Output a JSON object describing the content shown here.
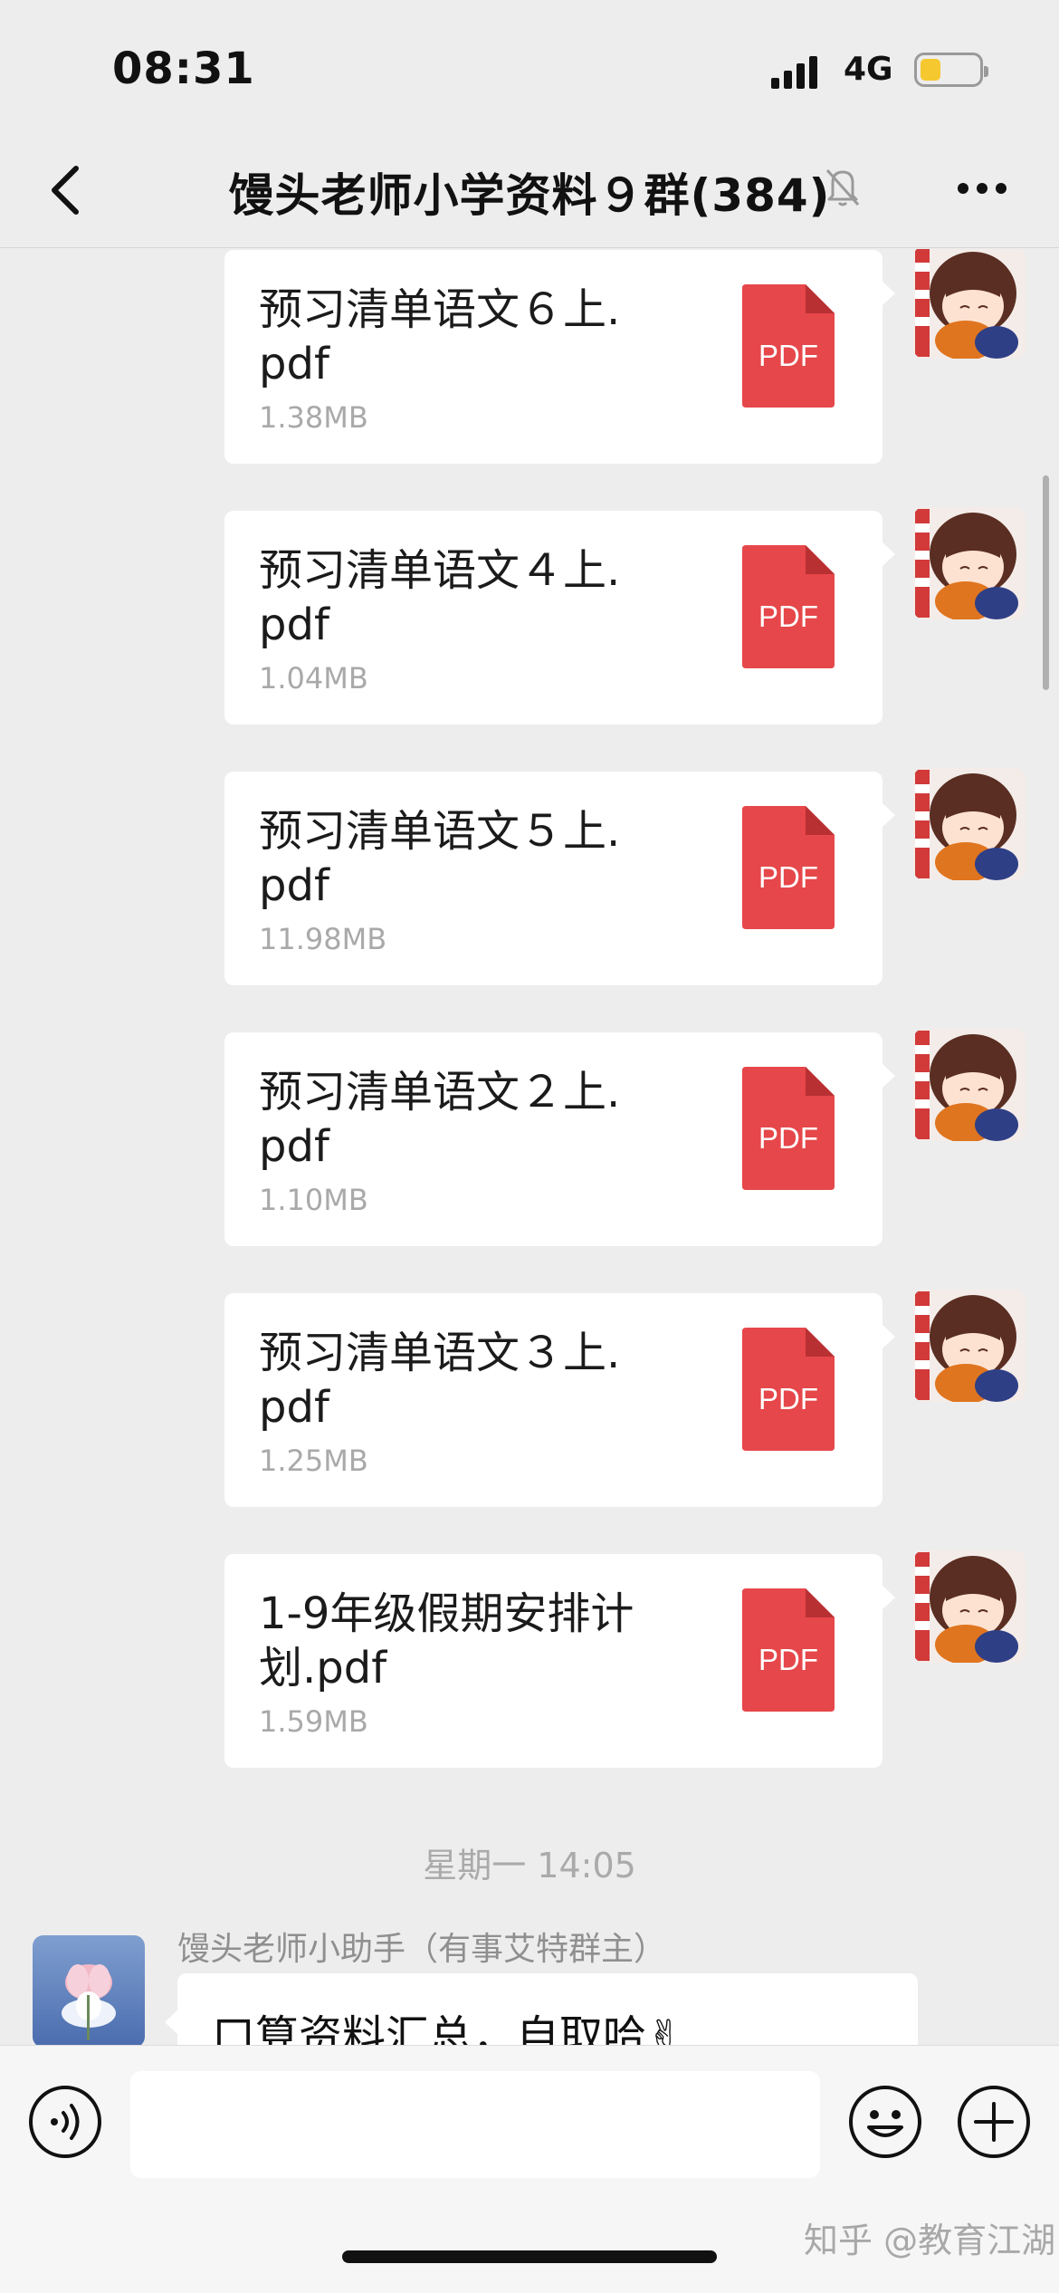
{
  "status_bar": {
    "time": "08:31",
    "network": "4G",
    "battery_level": 0.35
  },
  "nav": {
    "title": "馒头老师小学资料９群(384)",
    "back_icon": "chevron-left-icon",
    "mute_icon": "bell-muted-icon",
    "more_icon": "ellipsis-icon"
  },
  "messages": [
    {
      "name": "预习清单语文６上.pdf",
      "size": "1.38MB",
      "icon_label": "PDF"
    },
    {
      "name": "预习清单语文４上.pdf",
      "size": "1.04MB",
      "icon_label": "PDF"
    },
    {
      "name": "预习清单语文５上.pdf",
      "size": "11.98MB",
      "icon_label": "PDF"
    },
    {
      "name": "预习清单语文２上.pdf",
      "size": "1.10MB",
      "icon_label": "PDF"
    },
    {
      "name": "预习清单语文３上.pdf",
      "size": "1.25MB",
      "icon_label": "PDF"
    },
    {
      "name": "1-9年级假期安排计划.pdf",
      "size": "1.59MB",
      "icon_label": "PDF"
    }
  ],
  "time_divider": "星期一 14:05",
  "incoming": {
    "sender": "馒头老师小助手（有事艾特群主）",
    "text": "口算资料汇总，自取哈✌"
  },
  "input_bar": {
    "voice_icon": "voice-icon",
    "emoji_icon": "emoji-icon",
    "plus_icon": "plus-icon",
    "placeholder": ""
  },
  "watermark": "知乎 @教育江湖",
  "colors": {
    "background": "#ededed",
    "bubble": "#ffffff",
    "pdf_red": "#e6474a",
    "muted_text": "#a9a9a9"
  }
}
